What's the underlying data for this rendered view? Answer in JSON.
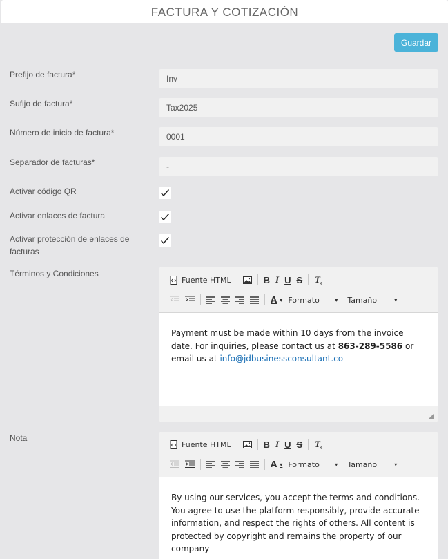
{
  "header": {
    "title": "FACTURA Y COTIZACIÓN"
  },
  "actions": {
    "save_label": "Guardar"
  },
  "fields": {
    "prefix": {
      "label": "Prefijo de factura*",
      "value": "Inv"
    },
    "suffix": {
      "label": "Sufijo de factura*",
      "value": "Tax2025"
    },
    "start_number": {
      "label": "Número de inicio de factura*",
      "value": "0001"
    },
    "separator": {
      "label": "Separador de facturas*",
      "value": "-"
    },
    "qr": {
      "label": "Activar código QR",
      "checked": true
    },
    "links": {
      "label": "Activar enlaces de factura",
      "checked": true
    },
    "link_protection": {
      "label": "Activar protección de enlaces de facturas",
      "checked": true
    }
  },
  "toolbar": {
    "source_label": "Fuente HTML",
    "format_label": "Formato",
    "size_label": "Tamaño",
    "bold": "B",
    "italic": "I",
    "underline": "U",
    "strike": "S",
    "font_color": "A"
  },
  "terms": {
    "label": "Términos y Condiciones",
    "text_before": "Payment must be made within 10 days from the invoice date. For inquiries, please contact us at ",
    "phone": "863-289-5586",
    "text_middle": " or email us at ",
    "email": "info@jdbusinessconsultant.co"
  },
  "note": {
    "label": "Nota",
    "text": "By using our services, you accept the terms and conditions. You agree to use the platform responsibly, provide accurate information, and respect the rights of others. All content is protected by copyright and remains the property of our company"
  },
  "colors": {
    "accent": "#4bb3d9",
    "link": "#1a6fb5",
    "background": "#e6e6e8"
  }
}
